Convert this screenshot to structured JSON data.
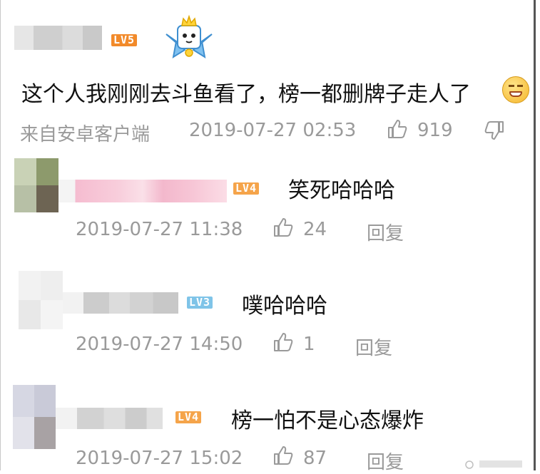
{
  "main_comment": {
    "level": "LV5",
    "text": "这个人我刚刚去斗鱼看了，榜一都删牌子走人了",
    "source": "来自安卓客户端",
    "time": "2019-07-27 02:53",
    "likes": "919",
    "level_color": "#f28a2a"
  },
  "replies": [
    {
      "level": "LV4",
      "text": "笑死哈哈哈",
      "time": "2019-07-27 11:38",
      "likes": "24",
      "reply_label": "回复",
      "level_color": "#f5a44a"
    },
    {
      "level": "LV3",
      "text": "噗哈哈哈",
      "time": "2019-07-27 14:50",
      "likes": "1",
      "reply_label": "回复",
      "level_color": "#7fc4e8"
    },
    {
      "level": "LV4",
      "text": "榜一怕不是心态爆炸",
      "time": "2019-07-27 15:02",
      "likes": "87",
      "reply_label": "回复",
      "level_color": "#f5a44a"
    }
  ],
  "icons": {
    "like": "thumbs-up-icon",
    "dislike": "thumbs-down-icon",
    "emoji": "grinning-emoji",
    "mascot": "crowned-mascot-icon"
  }
}
